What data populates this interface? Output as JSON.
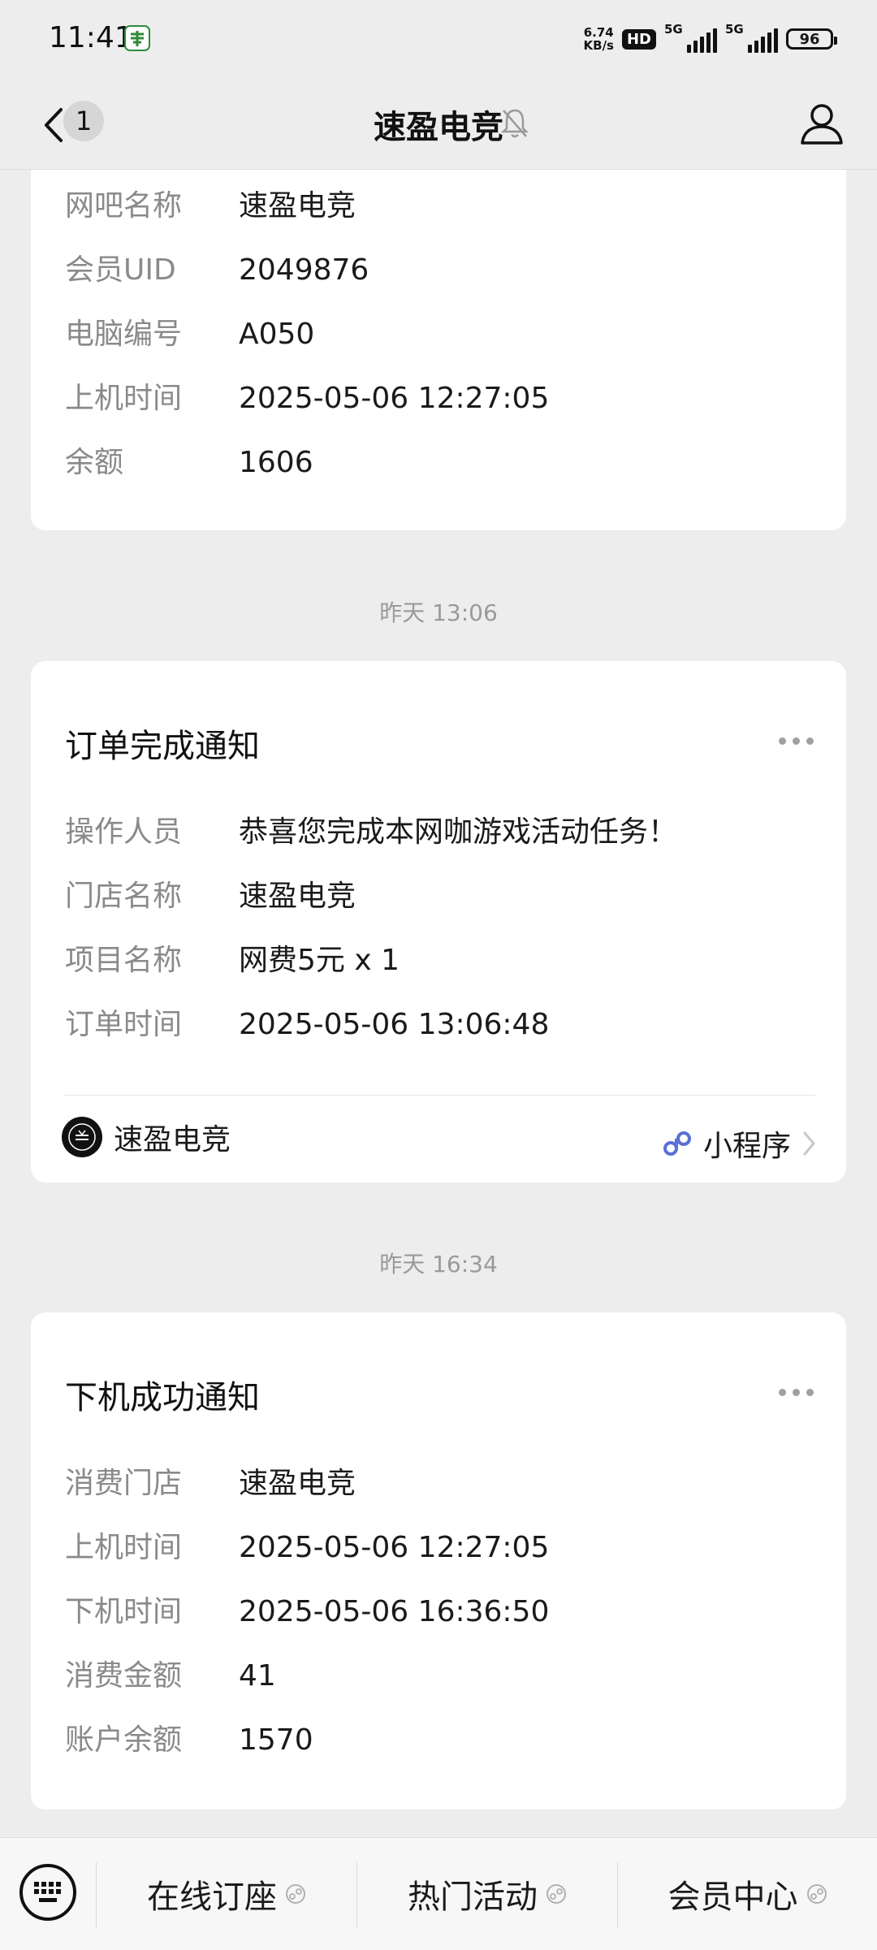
{
  "status_bar": {
    "time": "11:41",
    "net_speed_value": "6.74",
    "net_speed_unit": "KB/s",
    "hd_label": "HD",
    "sim1_label": "5G",
    "sim2_label": "5G",
    "battery": "96"
  },
  "nav": {
    "unread_count": "1",
    "title": "速盈电竞"
  },
  "card1": {
    "rows": [
      {
        "label": "网吧名称",
        "value": "速盈电竞"
      },
      {
        "label": "会员UID",
        "value": "2049876"
      },
      {
        "label": "电脑编号",
        "value": "A050"
      },
      {
        "label": "上机时间",
        "value": "2025-05-06 12:27:05"
      },
      {
        "label": "余额",
        "value": "1606"
      }
    ]
  },
  "timestamp1": "昨天 13:06",
  "card2": {
    "title": "订单完成通知",
    "rows": [
      {
        "label": "操作人员",
        "value": "恭喜您完成本网咖游戏活动任务！"
      },
      {
        "label": "门店名称",
        "value": "速盈电竞"
      },
      {
        "label": "项目名称",
        "value": "网费5元 x 1"
      },
      {
        "label": "订单时间",
        "value": "2025-05-06 13:06:48"
      }
    ],
    "footer_name": "速盈电竞",
    "footer_link": "小程序"
  },
  "timestamp2": "昨天 16:34",
  "card3": {
    "title": "下机成功通知",
    "rows": [
      {
        "label": "消费门店",
        "value": "速盈电竞"
      },
      {
        "label": "上机时间",
        "value": "2025-05-06 12:27:05"
      },
      {
        "label": "下机时间",
        "value": "2025-05-06 16:36:50"
      },
      {
        "label": "消费金额",
        "value": "41"
      },
      {
        "label": "账户余额",
        "value": "1570"
      }
    ]
  },
  "bottom_menu": {
    "items": [
      {
        "label": "在线订座"
      },
      {
        "label": "热门活动"
      },
      {
        "label": "会员中心"
      }
    ]
  },
  "colors": {
    "background": "#ededed",
    "card": "#ffffff",
    "label_gray": "#8a8a8a",
    "mini_program_blue": "#5b6fd6"
  }
}
